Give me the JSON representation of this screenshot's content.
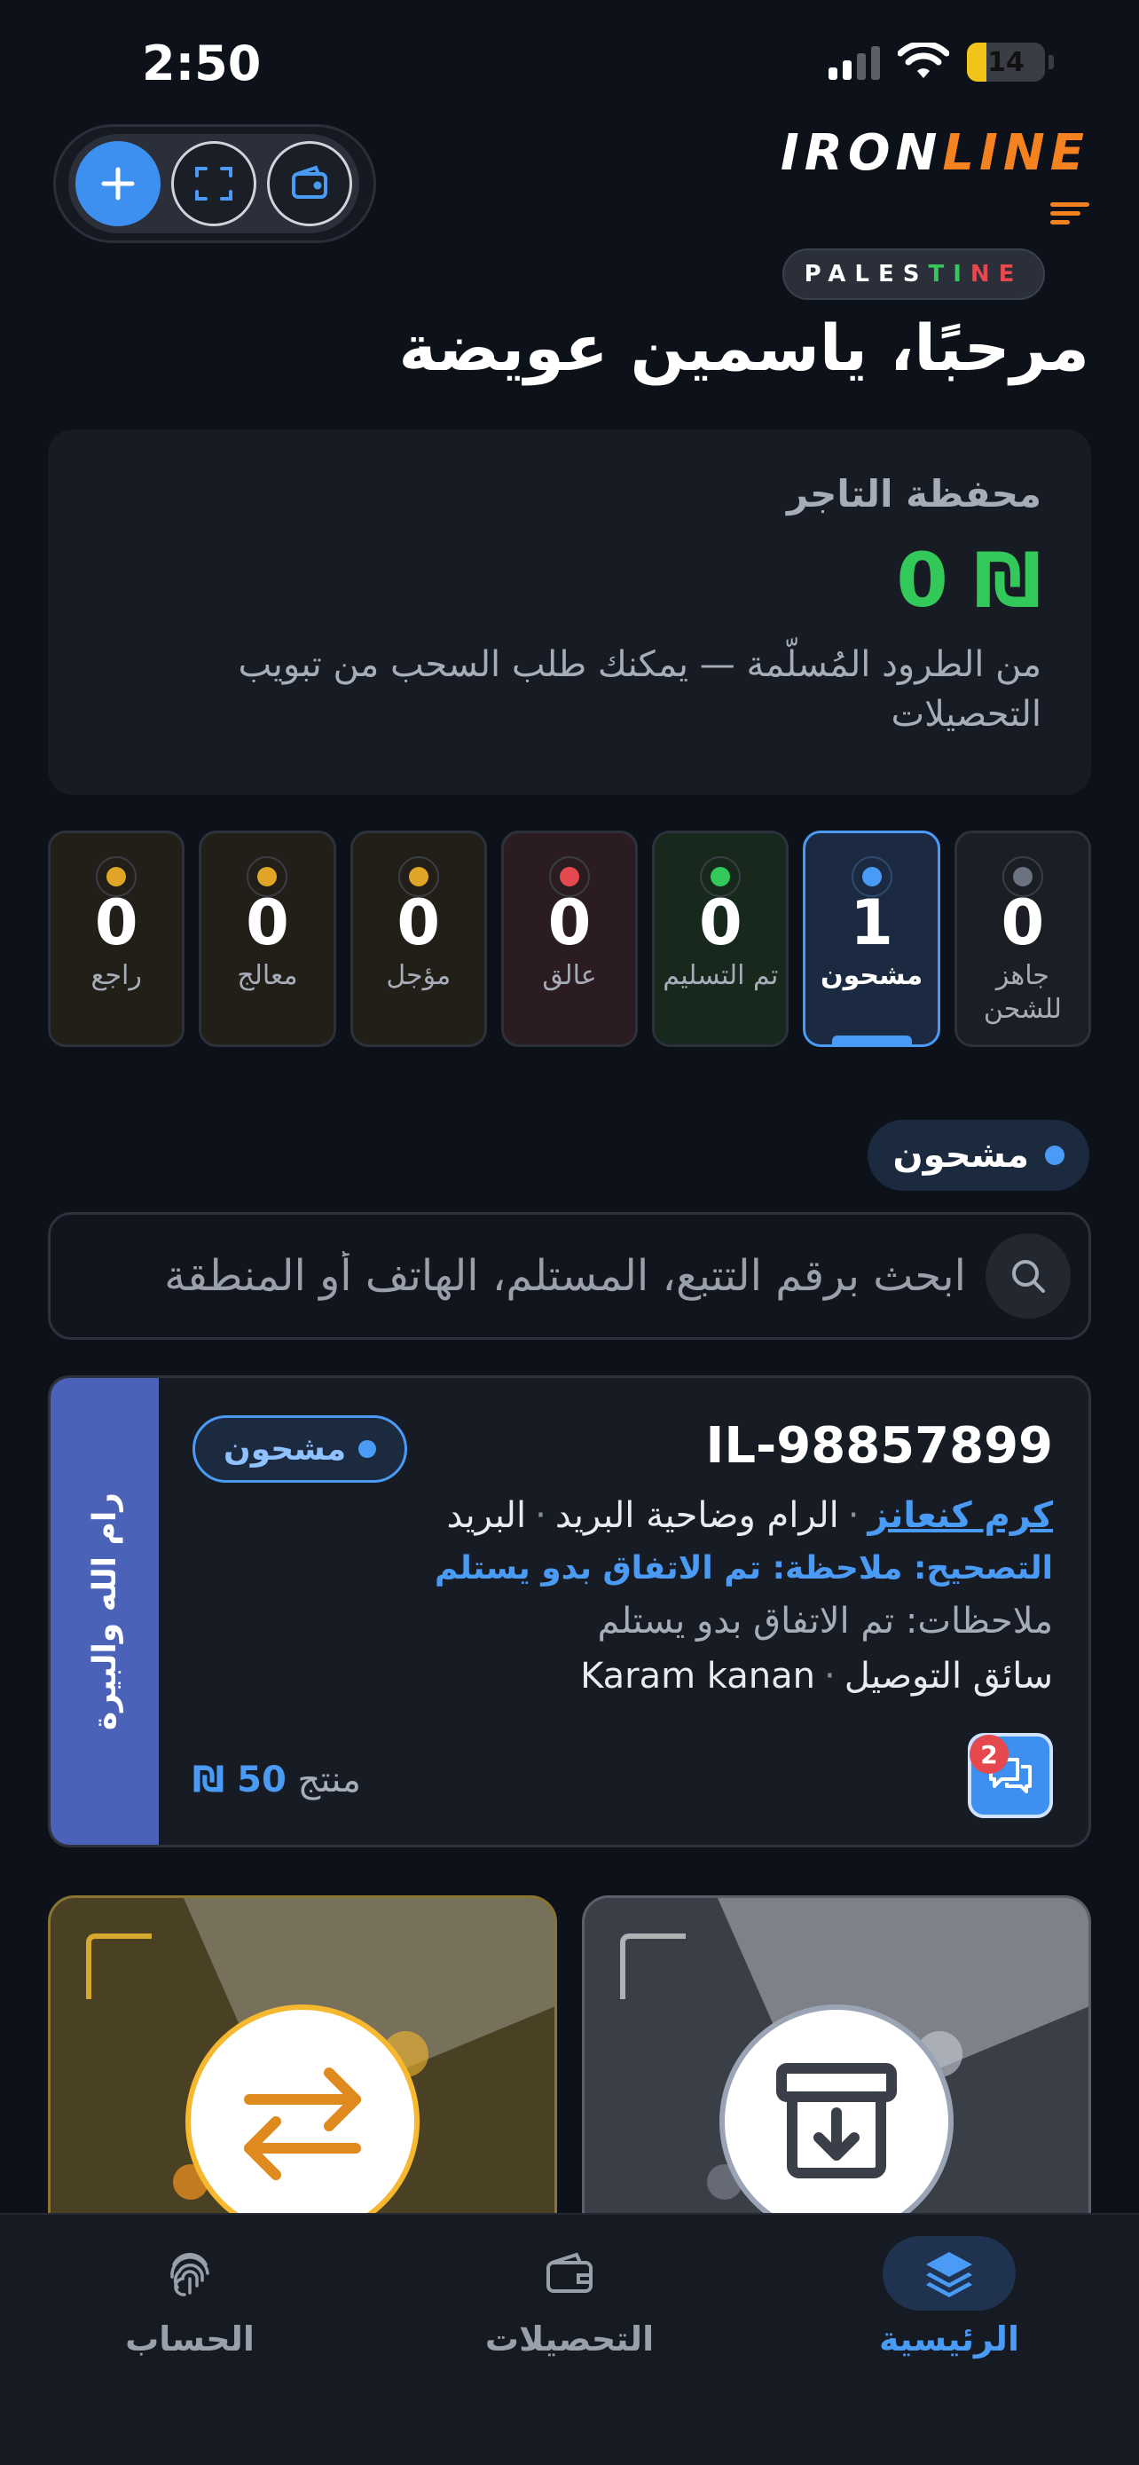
{
  "status_bar": {
    "time": "2:50",
    "battery": "14"
  },
  "brand": {
    "word_white": "IRON",
    "word_orange": "LINE",
    "badge": "PALESTINE"
  },
  "greeting": "مرحبًا، ياسمين عويضة",
  "wallet": {
    "title": "محفظة التاجر",
    "amount": "0 ₪",
    "note": "من الطرود المُسلّمة — يمكنك طلب السحب من تبويب التحصيلات"
  },
  "counters": [
    {
      "value": "0",
      "label": "جاهز للشحن",
      "color": "#6b7280"
    },
    {
      "value": "1",
      "label": "مشحون",
      "color": "#4a9bf5",
      "active": true
    },
    {
      "value": "0",
      "label": "تم التسليم",
      "color": "#33c85a"
    },
    {
      "value": "0",
      "label": "عالق",
      "color": "#e5484d"
    },
    {
      "value": "0",
      "label": "مؤجل",
      "color": "#e0a526"
    },
    {
      "value": "0",
      "label": "معالج",
      "color": "#e0a526"
    },
    {
      "value": "0",
      "label": "راجع",
      "color": "#e0a526"
    }
  ],
  "filter": {
    "label": "مشحون"
  },
  "search": {
    "placeholder": "ابحث برقم التتبع، المستلم، الهاتف أو المنطقة"
  },
  "shipment": {
    "region": "رام الله والبيرة",
    "tracking": "IL-98857899",
    "status": "مشحون",
    "merchant": "كرم كنعانز",
    "area": "الرام وضاحية البريد",
    "subarea": "البريد",
    "correction": "التصحيح: ملاحظة: تم الاتفاق بدو يستلم",
    "notes": "ملاحظات: تم الاتفاق بدو يستلم",
    "driver_label": "سائق التوصيل",
    "driver_name": "Karam kanan",
    "price_label": "منتج",
    "price_value": "50 ₪",
    "chat_badge": "2"
  },
  "nav": {
    "home": "الرئيسية",
    "collections": "التحصيلات",
    "account": "الحساب"
  },
  "colors": {
    "accent": "#4a9bf5",
    "brand_orange": "#f58220",
    "success": "#33c85a"
  }
}
